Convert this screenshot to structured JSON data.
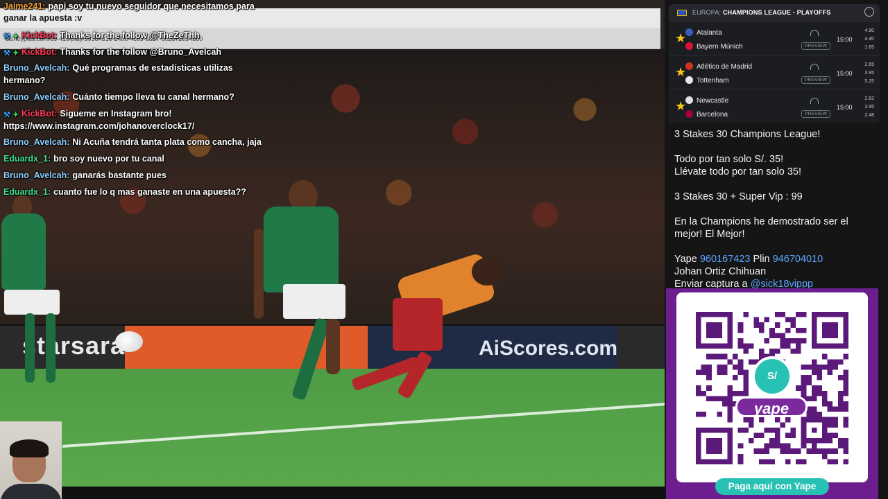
{
  "chat": {
    "messages": [
      {
        "user": "Jaime241:",
        "text": "papi soy tu nuevo seguidor que necesitamos para",
        "user_color": "#f2a23a"
      },
      {
        "user": "",
        "text": "ganar la apuesta :v",
        "user_color": "#ffffff"
      },
      {
        "user": "KickBot:",
        "text": "Thanks for the follow @TheZeThh",
        "user_color": "#ff3b57",
        "badges": true
      },
      {
        "user": "KickBot:",
        "text": "Thanks for the follow @Bruno_Avelcah",
        "user_color": "#ff3b57",
        "badges": true
      },
      {
        "user": "Bruno_Avelcah:",
        "text": "Qué programas de estadísticas utilizas",
        "user_color": "#8fd0ff"
      },
      {
        "user": "",
        "text": "hermano?",
        "user_color": "#ffffff"
      },
      {
        "user": "Bruno_Avelcah:",
        "text": "Cuánto tiempo lleva tu canal hermano?",
        "user_color": "#8fd0ff"
      },
      {
        "user": "KickBot:",
        "text": "Sigueme en Instagram bro!",
        "user_color": "#ff3b57",
        "badges": true
      },
      {
        "user": "",
        "text": "https://www.instagram.com/johanoverclock17/",
        "user_color": "#ffffff"
      },
      {
        "user": "Bruno_Avelcah:",
        "text": "Ni Acuña tendrá tanta plata como cancha, jaja",
        "user_color": "#8fd0ff"
      },
      {
        "user": "Eduardx_1:",
        "text": "bro soy nuevo por tu canal",
        "user_color": "#3ee08c"
      },
      {
        "user": "Bruno_Avelcah:",
        "text": "ganarás bastante pues",
        "user_color": "#8fd0ff"
      },
      {
        "user": "Eduardx_1:",
        "text": "cuanto fue lo q mas ganaste en una apuesta??",
        "user_color": "#3ee08c"
      }
    ]
  },
  "browser": {
    "url": "disneyplus.com/es-419/play/3938431e-24bc-4cb3-a8e7-6c2d72e34bb0"
  },
  "video": {
    "ad_left": "starsara",
    "ad_right": "AiScores.com"
  },
  "matches": {
    "header_comp": "EUROPA:",
    "header_title": "CHAMPIONS LEAGUE - PLAYOFFS",
    "preview_label": "PREVIEW",
    "items": [
      {
        "home": "Atalanta",
        "away": "Bayern Múnich",
        "time": "15:00",
        "odds": [
          "4.90",
          "4.40",
          "1.65"
        ],
        "home_color": "#3a5bb8",
        "away_color": "#dc143c"
      },
      {
        "home": "Atlético de Madrid",
        "away": "Tottenham",
        "time": "15:00",
        "odds": [
          "2.65",
          "3.95",
          "5.25"
        ],
        "home_color": "#cb3524",
        "away_color": "#e8e8e8"
      },
      {
        "home": "Newcastle",
        "away": "Barcelona",
        "time": "15:00",
        "odds": [
          "2.62",
          "3.95",
          "2.48"
        ],
        "home_color": "#e0e0e0",
        "away_color": "#a50044"
      }
    ]
  },
  "promo": {
    "line1": "3 Stakes 30 Champions League!",
    "line2": "Todo por tan solo S/. 35!",
    "line3": "Llévate todo por tan solo 35!",
    "line4": "3 Stakes 30 + Super Vip : 99",
    "line5": "En la Champions he demostrado ser el mejor! El Mejor!",
    "yape_label": "Yape",
    "yape_number": "960167423",
    "plin_label": "Plin",
    "plin_number": "946704010",
    "name": "Johan Ortiz Chihuan",
    "send_label": "Enviar captura a",
    "send_handle": "@sick18vippp"
  },
  "yape": {
    "badge": "S/",
    "word": "yape",
    "button": "Paga aquí con Yape"
  },
  "colors": {
    "accent_purple": "#6c1e8e",
    "accent_teal": "#27c2b4",
    "star": "#f2c318",
    "link_blue": "#5aa8ff"
  }
}
